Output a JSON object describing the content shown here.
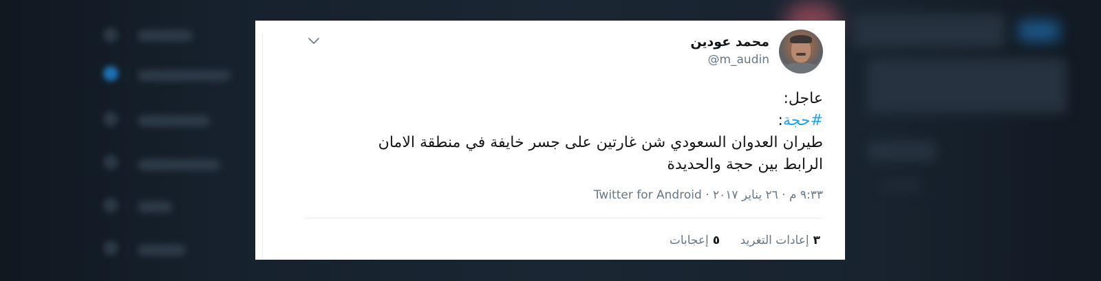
{
  "tweet": {
    "author": {
      "display_name": "محمد عودين",
      "username": "@m_audin"
    },
    "text": {
      "line1": "عاجل:",
      "hashtag": "#حجة",
      "hashtag_suffix": ":",
      "line3": "طيران العدوان السعودي  شن غارتين على جسر خايفة في منطقة الامان",
      "line4": "الرابط بين حجة والحديدة"
    },
    "timestamp": "٩:٣٣ م · ٢٦ يناير ٢٠١٧",
    "separator": " · ",
    "source": "Twitter for Android",
    "stats": {
      "retweets_count": "٣",
      "retweets_label": "إعادات التغريد",
      "likes_count": "٥",
      "likes_label": "إعجابات"
    },
    "menu_icon": "chevron-down-icon"
  },
  "colors": {
    "link": "#1da1f2",
    "text": "#14171a",
    "secondary": "#657786",
    "background": "#151f2b"
  }
}
